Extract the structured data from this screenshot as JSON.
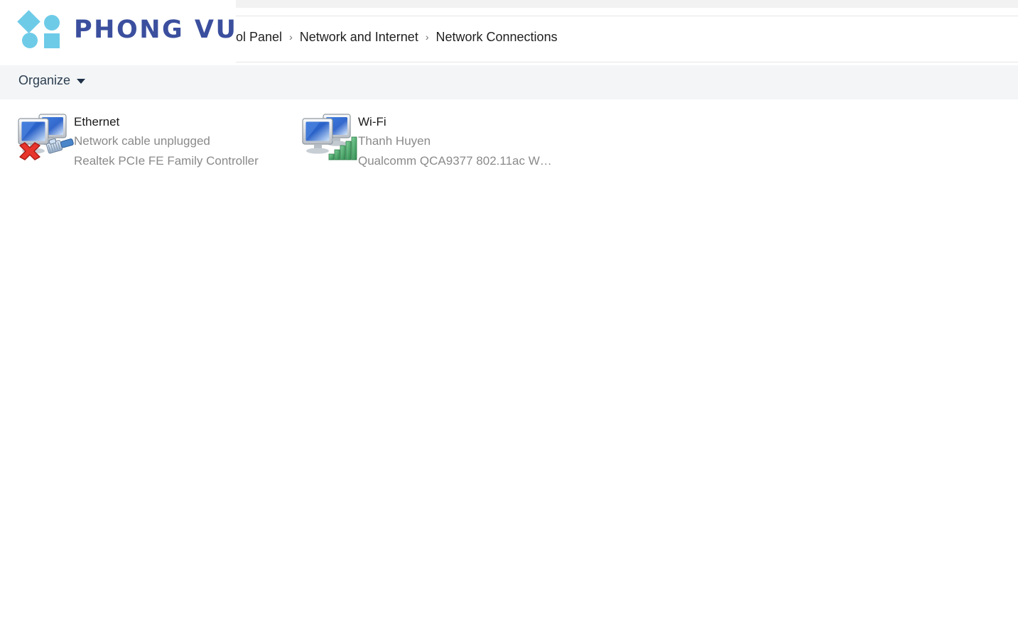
{
  "window": {
    "top_strip_present": true
  },
  "brand": {
    "wordmark": "PHONG VU",
    "mark_color": "#6ecbe8",
    "wordmark_color": "#3b4f9e",
    "shapes": [
      "diamond",
      "circle",
      "circle",
      "square"
    ]
  },
  "breadcrumb": {
    "items": [
      {
        "label": "ol Panel",
        "truncated_from_left": true
      },
      {
        "label": "Network and Internet"
      },
      {
        "label": "Network Connections"
      }
    ],
    "separator": "›"
  },
  "commandbar": {
    "organize_label": "Organize",
    "caret": "chevron-down-icon",
    "background": "#f3f5f7"
  },
  "connections": [
    {
      "id": "ethernet",
      "name": "Ethernet",
      "status": "Network cable unplugged",
      "adapter": "Realtek PCIe FE Family Controller",
      "icon": "network-monitors-disconnected-icon",
      "overlay": "red-x-icon",
      "accessory": "rj45-plug-icon"
    },
    {
      "id": "wifi",
      "name": "Wi-Fi",
      "status": "Thanh Huyen",
      "adapter": "Qualcomm QCA9377 802.11ac W…",
      "icon": "network-monitors-connected-icon",
      "overlay": "signal-bars-icon",
      "accessory": "signal-bars-icon"
    }
  ]
}
